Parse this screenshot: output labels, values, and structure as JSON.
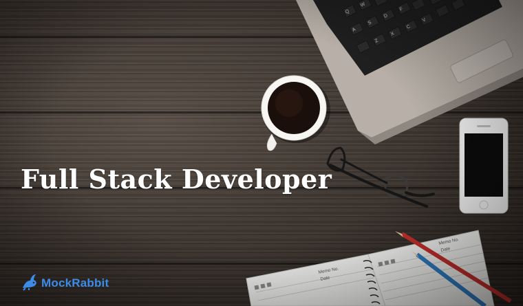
{
  "headline": "Full Stack Developer",
  "logo": {
    "text": "MockRabbit",
    "icon": "rabbit-icon",
    "color": "#3d8be8"
  },
  "objects": {
    "laptop": "laptop-icon",
    "coffee": "coffee-cup-icon",
    "phone": "smartphone-icon",
    "glasses": "eyeglasses-icon",
    "notebook": "notebook-icon",
    "pencils": "pencil-icon"
  },
  "notebook_labels": {
    "memo_no": "Memo No.",
    "date": "Date"
  },
  "colors": {
    "wood": "#3f3731",
    "headline": "#ffffff",
    "pencil_red": "#c9302c",
    "pencil_blue": "#2f7fc8"
  }
}
